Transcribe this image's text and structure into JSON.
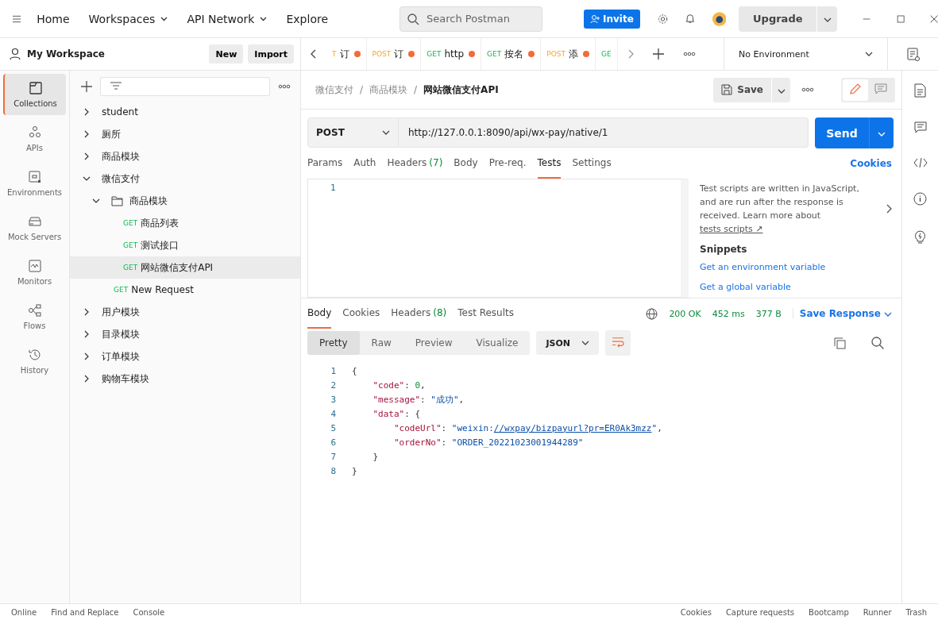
{
  "top_bar": {
    "nav": [
      "Home",
      "Workspaces",
      "API Network",
      "Explore"
    ],
    "search": {
      "placeholder": "Search Postman"
    },
    "invite": "Invite",
    "upgrade": "Upgrade"
  },
  "workspace": {
    "title": "My Workspace",
    "buttons": [
      "New",
      "Import"
    ]
  },
  "request_tabs": [
    {
      "method": "T",
      "kind": "post",
      "name": "订",
      "unsaved": true
    },
    {
      "method": "POST",
      "kind": "post",
      "name": "订",
      "unsaved": true
    },
    {
      "method": "GET",
      "kind": "get",
      "name": "http",
      "unsaved": true
    },
    {
      "method": "GET",
      "kind": "get",
      "name": "按名",
      "unsaved": true
    },
    {
      "method": "POST",
      "kind": "post",
      "name": "添",
      "unsaved": true
    },
    {
      "method": "GE",
      "kind": "get",
      "unsaved": false
    }
  ],
  "environment": "No Environment",
  "sidebar": {
    "items": [
      {
        "label": "Collections",
        "selected": true
      },
      {
        "label": "APIs",
        "selected": false
      },
      {
        "label": "Environments",
        "selected": false
      },
      {
        "label": "Mock Servers",
        "selected": false
      },
      {
        "label": "Monitors",
        "selected": false
      },
      {
        "label": "Flows",
        "selected": false
      },
      {
        "label": "History",
        "selected": false
      }
    ]
  },
  "collections": [
    {
      "kind": "collection",
      "name": "student",
      "expanded": false
    },
    {
      "kind": "collection",
      "name": "厕所",
      "expanded": false
    },
    {
      "kind": "collection",
      "name": "商品模块",
      "expanded": false
    },
    {
      "kind": "collection",
      "name": "微信支付",
      "expanded": true,
      "children": [
        {
          "kind": "folder",
          "name": "商品模块",
          "expanded": true,
          "children": [
            {
              "kind": "request",
              "method": "GET",
              "name": "商品列表",
              "selected": false
            },
            {
              "kind": "request",
              "method": "GET",
              "name": "测试接口",
              "selected": false
            },
            {
              "kind": "request",
              "method": "GET",
              "name": "网站微信支付API",
              "selected": true
            }
          ]
        },
        {
          "kind": "request",
          "method": "GET",
          "name": "New Request",
          "selected": false
        }
      ]
    },
    {
      "kind": "collection",
      "name": "用户模块",
      "expanded": false
    },
    {
      "kind": "collection",
      "name": "目录模块",
      "expanded": false
    },
    {
      "kind": "collection",
      "name": "订单模块",
      "expanded": false
    },
    {
      "kind": "collection",
      "name": "购物车模块",
      "expanded": false
    }
  ],
  "breadcrumb": [
    {
      "name": "微信支付"
    },
    {
      "separator": "/",
      "name": "商品模块"
    },
    {
      "separator": "/",
      "name": "网站微信支付API"
    }
  ],
  "save": "Save",
  "request": {
    "method": "POST",
    "url": "http://127.0.0.1:8090/api/wx-pay/native/1",
    "send": "Send"
  },
  "request_tabs_bar": [
    {
      "label": "Params",
      "selected": false
    },
    {
      "label": "Auth",
      "selected": false
    },
    {
      "label": "Headers",
      "count": "(7)",
      "selected": false
    },
    {
      "label": "Body",
      "selected": false
    },
    {
      "label": "Pre-req.",
      "selected": false
    },
    {
      "label": "Tests",
      "selected": true
    },
    {
      "label": "Settings",
      "selected": false
    }
  ],
  "cookies_link": "Cookies",
  "editor_line": "1",
  "help": {
    "text": "Test scripts are written in JavaScript, and are run after the response is received. Learn more about",
    "link": "tests scripts",
    "link_mark": "↗",
    "snippets_title": "Snippets",
    "snippets": [
      "Get an environment variable",
      "Get a global variable"
    ]
  },
  "response": {
    "tabs": [
      {
        "label": "Body",
        "selected": true
      },
      {
        "label": "Cookies",
        "selected": false
      },
      {
        "label": "Headers",
        "count": "(8)",
        "selected": false
      },
      {
        "label": "Test Results",
        "selected": false
      }
    ],
    "status": "200 OK",
    "time": "452 ms",
    "size": "377 B",
    "save_response": "Save Response",
    "views": [
      {
        "label": "Pretty",
        "selected": true
      },
      {
        "label": "Raw",
        "selected": false
      },
      {
        "label": "Preview",
        "selected": false
      },
      {
        "label": "Visualize",
        "selected": false
      }
    ],
    "format": "JSON",
    "lines": [
      {
        "number": "1",
        "tokens": [
          {
            "kind": "punct",
            "text": "{"
          }
        ],
        "children": [
          {
            "number": "2",
            "tokens": [
              {
                "kind": "key",
                "text": "\"code\""
              },
              {
                "kind": "punct",
                "text": ": "
              },
              {
                "kind": "number",
                "text": "0"
              },
              {
                "kind": "punct",
                "text": ","
              }
            ]
          },
          {
            "number": "3",
            "tokens": [
              {
                "kind": "key",
                "text": "\"message\""
              },
              {
                "kind": "punct",
                "text": ": "
              },
              {
                "kind": "string",
                "text": "\"成功\""
              },
              {
                "kind": "punct",
                "text": ","
              }
            ]
          },
          {
            "number": "4",
            "tokens": [
              {
                "kind": "key",
                "text": "\"data\""
              },
              {
                "kind": "punct",
                "text": ": {"
              }
            ],
            "children": [
              {
                "number": "5",
                "tokens": [
                  {
                    "kind": "key",
                    "text": "\"codeUrl\""
                  },
                  {
                    "kind": "punct",
                    "text": ": "
                  },
                  {
                    "kind": "string",
                    "text": "\"weixin:"
                  },
                  {
                    "kind": "link",
                    "text": "//wxpay/bizpayurl?pr=ER0Ak3mzz"
                  },
                  {
                    "kind": "string",
                    "text": "\""
                  },
                  {
                    "kind": "punct",
                    "text": ","
                  }
                ]
              },
              {
                "number": "6",
                "tokens": [
                  {
                    "kind": "key",
                    "text": "\"orderNo\""
                  },
                  {
                    "kind": "punct",
                    "text": ": "
                  },
                  {
                    "kind": "string",
                    "text": "\"ORDER_20221023001944289\""
                  }
                ]
              }
            ]
          },
          {
            "number": "7",
            "tokens": [
              {
                "kind": "punct",
                "text": "}"
              }
            ]
          }
        ]
      },
      {
        "number": "8",
        "tokens": [
          {
            "kind": "punct",
            "text": "}"
          }
        ]
      }
    ]
  },
  "status_bar": {
    "left": [
      "Online",
      "Find and Replace",
      "Console"
    ],
    "right": [
      "Cookies",
      "Capture requests",
      "Bootcamp",
      "Runner",
      "Trash"
    ]
  }
}
